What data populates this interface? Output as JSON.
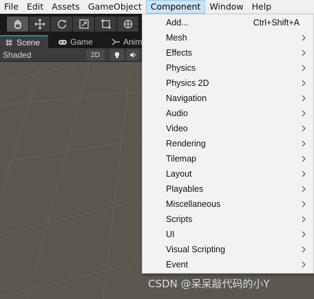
{
  "menubar": {
    "items": [
      "File",
      "Edit",
      "Assets",
      "GameObject",
      "Component",
      "Window",
      "Help"
    ],
    "active": "Component"
  },
  "toolbar": {
    "tools": [
      "hand-tool-icon",
      "move-tool-icon",
      "rotate-tool-icon",
      "scale-tool-icon",
      "rect-tool-icon",
      "transform-tool-icon"
    ]
  },
  "tabs": {
    "scene": "Scene",
    "game": "Game",
    "animator": "Anima"
  },
  "viewbar": {
    "draw_mode": "Shaded",
    "mode_2d": "2D",
    "lighting_icon": "lightbulb-icon",
    "audio_icon": "speaker-icon"
  },
  "component_menu": {
    "items": [
      {
        "label": "Add...",
        "shortcut": "Ctrl+Shift+A",
        "submenu": false
      },
      {
        "label": "Mesh",
        "submenu": true
      },
      {
        "label": "Effects",
        "submenu": true
      },
      {
        "label": "Physics",
        "submenu": true
      },
      {
        "label": "Physics 2D",
        "submenu": true
      },
      {
        "label": "Navigation",
        "submenu": true
      },
      {
        "label": "Audio",
        "submenu": true
      },
      {
        "label": "Video",
        "submenu": true
      },
      {
        "label": "Rendering",
        "submenu": true
      },
      {
        "label": "Tilemap",
        "submenu": true
      },
      {
        "label": "Layout",
        "submenu": true
      },
      {
        "label": "Playables",
        "submenu": true
      },
      {
        "label": "Miscellaneous",
        "submenu": true
      },
      {
        "label": "Scripts",
        "submenu": true
      },
      {
        "label": "UI",
        "submenu": true
      },
      {
        "label": "Visual Scripting",
        "submenu": true
      },
      {
        "label": "Event",
        "submenu": true
      }
    ]
  },
  "watermark": "CSDN @呆呆敲代码的小Y",
  "colors": {
    "menubar_bg": "#f0f0f0",
    "menu_active_bg": "#cce4f7",
    "dropdown_bg": "#f2f2f2",
    "toolbar_bg": "#191919",
    "scene_bg": "#5a5650",
    "tab_accent": "#3a79bb"
  }
}
